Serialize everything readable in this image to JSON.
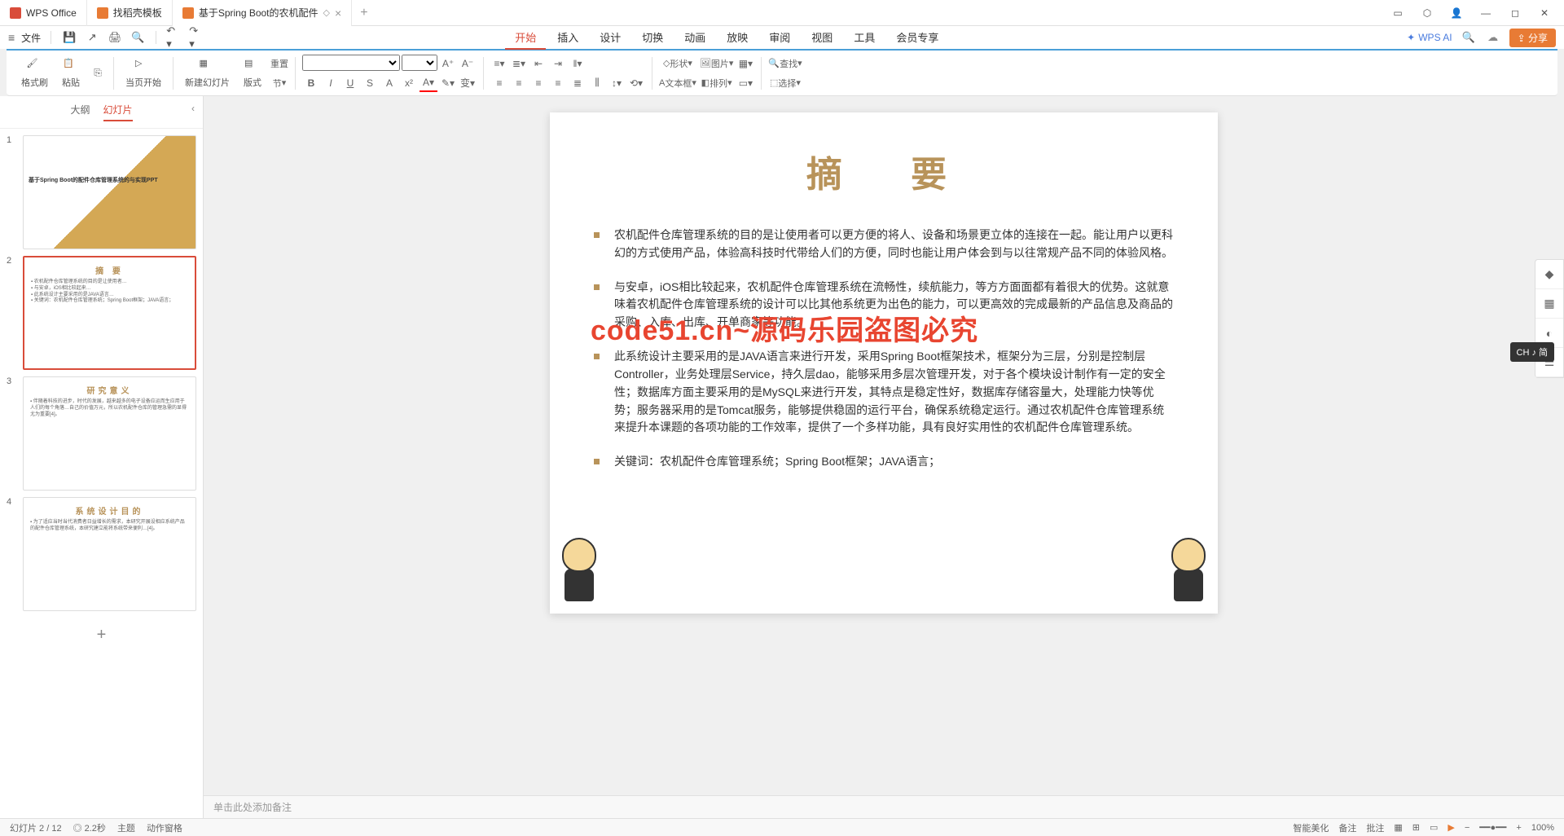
{
  "titlebar": {
    "tabs": [
      {
        "label": "WPS Office"
      },
      {
        "label": "找稻壳模板"
      },
      {
        "label": "基于Spring Boot的农机配件"
      }
    ],
    "add": "+"
  },
  "file_row": {
    "file": "文件",
    "menu_icons": [
      "save",
      "export",
      "print",
      "print-preview"
    ]
  },
  "menu_tabs": {
    "items": [
      "开始",
      "插入",
      "设计",
      "切换",
      "动画",
      "放映",
      "审阅",
      "视图",
      "工具",
      "会员专享"
    ],
    "active_index": 0,
    "ai": "WPS AI",
    "share": "分享"
  },
  "ribbon": {
    "format_brush": "格式刷",
    "paste": "粘贴",
    "from_current": "当页开始",
    "new_slide": "新建幻灯片",
    "layout": "版式",
    "section": "节",
    "reset": "重置",
    "shape": "形状",
    "image": "图片",
    "textbox": "文本框",
    "arrange": "排列",
    "find": "查找",
    "select": "选择"
  },
  "slide_panel": {
    "tabs": {
      "outline": "大纲",
      "slides": "幻灯片"
    },
    "thumbs": [
      {
        "num": "1",
        "title": "基于Spring Boot的配件仓库管理系统的与实现PPT"
      },
      {
        "num": "2",
        "title": "摘 要"
      },
      {
        "num": "3",
        "title": "研究意义"
      },
      {
        "num": "4",
        "title": "系统设计目的"
      }
    ]
  },
  "slide": {
    "title": "摘 要",
    "bullets": [
      "农机配件仓库管理系统的目的是让使用者可以更方便的将人、设备和场景更立体的连接在一起。能让用户以更科幻的方式使用产品，体验高科技时代带给人们的方便，同时也能让用户体会到与以往常规产品不同的体验风格。",
      "与安卓，iOS相比较起来，农机配件仓库管理系统在流畅性，续航能力，等方方面面都有着很大的优势。这就意味着农机配件仓库管理系统的设计可以比其他系统更为出色的能力，可以更高效的完成最新的产品信息及商品的采购、入库、出库、开单商家等功能。",
      "此系统设计主要采用的是JAVA语言来进行开发，采用Spring Boot框架技术，框架分为三层，分别是控制层Controller，业务处理层Service，持久层dao，能够采用多层次管理开发，对于各个模块设计制作有一定的安全性；数据库方面主要采用的是MySQL来进行开发，其特点是稳定性好，数据库存储容量大，处理能力快等优势；服务器采用的是Tomcat服务，能够提供稳固的运行平台，确保系统稳定运行。通过农机配件仓库管理系统来提升本课题的各项功能的工作效率，提供了一个多样功能，具有良好实用性的农机配件仓库管理系统。",
      "关键词：农机配件仓库管理系统；Spring Boot框架；JAVA语言；"
    ]
  },
  "watermark": "code51.cn~源码乐园盗图必究",
  "notes": "单击此处添加备注",
  "ime": "CH ♪ 简",
  "statusbar": {
    "left": [
      "幻灯片 2 / 12",
      "◎ 2.2秒",
      "主题",
      "动作窗格"
    ],
    "right": [
      "智能美化",
      "备注",
      "批注",
      "100%"
    ]
  }
}
